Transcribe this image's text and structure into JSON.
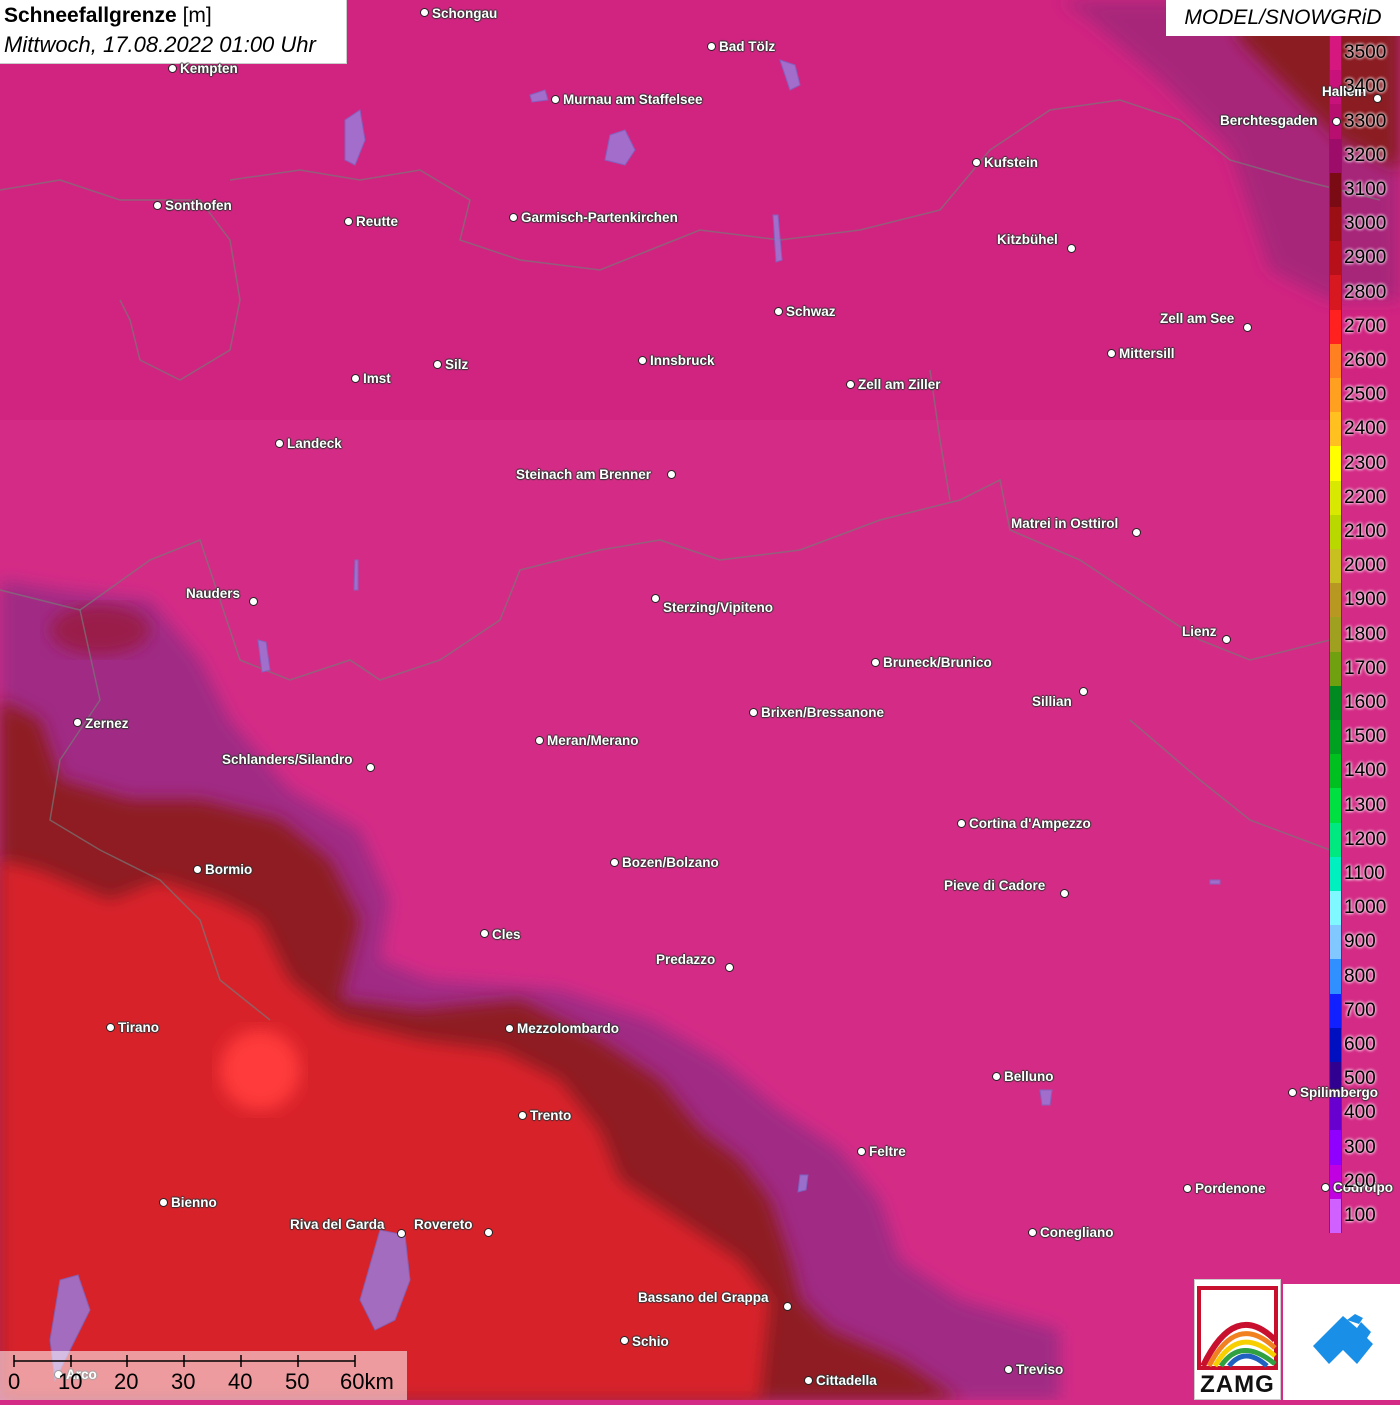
{
  "header": {
    "title_bold": "Schneefallgrenze",
    "title_unit": " [m]",
    "subtitle": "Mittwoch, 17.08.2022 01:00 Uhr"
  },
  "model_label": "MODEL/SNOWGRiD",
  "legend": {
    "ticks": [
      "3500",
      "3400",
      "3300",
      "3200",
      "3100",
      "3000",
      "2900",
      "2800",
      "2700",
      "2600",
      "2500",
      "2400",
      "2300",
      "2200",
      "2100",
      "2000",
      "1900",
      "1800",
      "1700",
      "1600",
      "1500",
      "1400",
      "1300",
      "1200",
      "1100",
      "1000",
      "900",
      "800",
      "700",
      "600",
      "500",
      "400",
      "300",
      "200",
      "100"
    ],
    "colors": [
      "#d6177f",
      "#c8117a",
      "#b80e70",
      "#9e0c6a",
      "#7a0a14",
      "#9a0e14",
      "#b8101a",
      "#d81820",
      "#ff2020",
      "#ff8020",
      "#ffa020",
      "#ffc020",
      "#ffff00",
      "#d8e800",
      "#b8d800",
      "#c8c020",
      "#b89820",
      "#a0a020",
      "#70a010",
      "#008a20",
      "#00a020",
      "#00c020",
      "#00e040",
      "#00e880",
      "#00f0c0",
      "#80f8ff",
      "#80c8ff",
      "#3090ff",
      "#1020ff",
      "#0010c0",
      "#300090",
      "#6800d0",
      "#9000ff",
      "#c000e0",
      "#d060ff"
    ]
  },
  "cities": [
    {
      "name": "Schongau",
      "dot": [
        424,
        12
      ],
      "label": [
        432,
        6
      ]
    },
    {
      "name": "Bad Tölz",
      "dot": [
        711,
        46
      ],
      "label": [
        719,
        39
      ]
    },
    {
      "name": "Kempten",
      "dot": [
        172,
        68
      ],
      "label": [
        180,
        61
      ]
    },
    {
      "name": "Murnau am Staffelsee",
      "dot": [
        555,
        99
      ],
      "label": [
        563,
        92
      ]
    },
    {
      "name": "Hallein",
      "dot": [
        1377,
        98
      ],
      "label": [
        1322,
        84
      ]
    },
    {
      "name": "Berchtesgaden",
      "dot": [
        1336,
        121
      ],
      "label": [
        1220,
        113
      ]
    },
    {
      "name": "Kufstein",
      "dot": [
        976,
        162
      ],
      "label": [
        984,
        155
      ]
    },
    {
      "name": "Sonthofen",
      "dot": [
        157,
        205
      ],
      "label": [
        165,
        198
      ]
    },
    {
      "name": "Reutte",
      "dot": [
        348,
        221
      ],
      "label": [
        356,
        214
      ]
    },
    {
      "name": "Garmisch-Partenkirchen",
      "dot": [
        513,
        217
      ],
      "label": [
        521,
        210
      ]
    },
    {
      "name": "Kitzbühel",
      "dot": [
        1071,
        248
      ],
      "label": [
        997,
        232
      ]
    },
    {
      "name": "Schwaz",
      "dot": [
        778,
        311
      ],
      "label": [
        786,
        304
      ]
    },
    {
      "name": "Zell am See",
      "dot": [
        1247,
        327
      ],
      "label": [
        1160,
        311
      ]
    },
    {
      "name": "Mittersill",
      "dot": [
        1111,
        353
      ],
      "label": [
        1119,
        346
      ]
    },
    {
      "name": "Innsbruck",
      "dot": [
        642,
        360
      ],
      "label": [
        650,
        353
      ]
    },
    {
      "name": "Silz",
      "dot": [
        437,
        364
      ],
      "label": [
        445,
        357
      ]
    },
    {
      "name": "Imst",
      "dot": [
        355,
        378
      ],
      "label": [
        363,
        371
      ]
    },
    {
      "name": "Zell am Ziller",
      "dot": [
        850,
        384
      ],
      "label": [
        858,
        377
      ]
    },
    {
      "name": "Landeck",
      "dot": [
        279,
        443
      ],
      "label": [
        287,
        436
      ]
    },
    {
      "name": "Steinach am Brenner",
      "dot": [
        671,
        474
      ],
      "label": [
        516,
        467
      ]
    },
    {
      "name": "Matrei in Osttirol",
      "dot": [
        1136,
        532
      ],
      "label": [
        1011,
        516
      ]
    },
    {
      "name": "Nauders",
      "dot": [
        253,
        601
      ],
      "label": [
        186,
        586
      ]
    },
    {
      "name": "Sterzing/Vipiteno",
      "dot": [
        655,
        598
      ],
      "label": [
        663,
        600
      ]
    },
    {
      "name": "Lienz",
      "dot": [
        1226,
        639
      ],
      "label": [
        1182,
        624
      ]
    },
    {
      "name": "Bruneck/Brunico",
      "dot": [
        875,
        662
      ],
      "label": [
        883,
        655
      ]
    },
    {
      "name": "Sillian",
      "dot": [
        1083,
        691
      ],
      "label": [
        1032,
        694
      ]
    },
    {
      "name": "Brixen/Bressanone",
      "dot": [
        753,
        712
      ],
      "label": [
        761,
        705
      ]
    },
    {
      "name": "Zernez",
      "dot": [
        77,
        722
      ],
      "label": [
        85,
        716
      ]
    },
    {
      "name": "Meran/Merano",
      "dot": [
        539,
        740
      ],
      "label": [
        547,
        733
      ]
    },
    {
      "name": "Schlanders/Silandro",
      "dot": [
        370,
        767
      ],
      "label": [
        222,
        752
      ]
    },
    {
      "name": "Cortina d'Ampezzo",
      "dot": [
        961,
        823
      ],
      "label": [
        969,
        816
      ]
    },
    {
      "name": "Bozen/Bolzano",
      "dot": [
        614,
        862
      ],
      "label": [
        622,
        855
      ]
    },
    {
      "name": "Bormio",
      "dot": [
        197,
        869
      ],
      "label": [
        205,
        862
      ]
    },
    {
      "name": "Pieve di Cadore",
      "dot": [
        1064,
        893
      ],
      "label": [
        944,
        878
      ]
    },
    {
      "name": "Cles",
      "dot": [
        484,
        933
      ],
      "label": [
        492,
        927
      ]
    },
    {
      "name": "Predazzo",
      "dot": [
        729,
        967
      ],
      "label": [
        656,
        952
      ]
    },
    {
      "name": "Tirano",
      "dot": [
        110,
        1027
      ],
      "label": [
        118,
        1020
      ]
    },
    {
      "name": "Mezzolombardo",
      "dot": [
        509,
        1028
      ],
      "label": [
        517,
        1021
      ]
    },
    {
      "name": "Belluno",
      "dot": [
        996,
        1076
      ],
      "label": [
        1004,
        1069
      ]
    },
    {
      "name": "Spilimbergo",
      "dot": [
        1292,
        1092
      ],
      "label": [
        1300,
        1085
      ]
    },
    {
      "name": "Trento",
      "dot": [
        522,
        1115
      ],
      "label": [
        530,
        1108
      ]
    },
    {
      "name": "Feltre",
      "dot": [
        861,
        1151
      ],
      "label": [
        869,
        1144
      ]
    },
    {
      "name": "Pordenone",
      "dot": [
        1187,
        1188
      ],
      "label": [
        1195,
        1181
      ]
    },
    {
      "name": "Codroipo",
      "dot": [
        1325,
        1187
      ],
      "label": [
        1333,
        1180
      ]
    },
    {
      "name": "Bienno",
      "dot": [
        163,
        1202
      ],
      "label": [
        171,
        1195
      ]
    },
    {
      "name": "Riva del Garda",
      "dot": [
        401,
        1233
      ],
      "label": [
        290,
        1217
      ]
    },
    {
      "name": "Rovereto",
      "dot": [
        488,
        1232
      ],
      "label": [
        414,
        1217
      ]
    },
    {
      "name": "Conegliano",
      "dot": [
        1032,
        1232
      ],
      "label": [
        1040,
        1225
      ]
    },
    {
      "name": "Bassano del Grappa",
      "dot": [
        787,
        1306
      ],
      "label": [
        638,
        1290
      ]
    },
    {
      "name": "Schio",
      "dot": [
        624,
        1340
      ],
      "label": [
        632,
        1334
      ]
    },
    {
      "name": "Treviso",
      "dot": [
        1008,
        1369
      ],
      "label": [
        1016,
        1362
      ]
    },
    {
      "name": "Cittadella",
      "dot": [
        808,
        1380
      ],
      "label": [
        816,
        1373
      ]
    },
    {
      "name": "Arco",
      "dot": [
        58,
        1374
      ],
      "label": [
        66,
        1367
      ]
    }
  ],
  "scalebar": {
    "labels": [
      "0",
      "10",
      "20",
      "30",
      "40",
      "50",
      "60km"
    ]
  },
  "logo": {
    "text": "ZAMG"
  }
}
